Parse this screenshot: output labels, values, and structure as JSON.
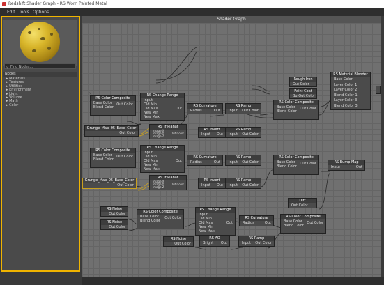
{
  "window": {
    "title": "Redshift Shader Graph - RS Worn Painted Metal"
  },
  "menu": [
    "Edit",
    "Tools",
    "Options"
  ],
  "left_panel": {
    "search_placeholder": "Find Nodes...",
    "tree_header": "Nodes",
    "tree_items": [
      "Materials",
      "Textures",
      "Utilities",
      "Environment",
      "Light",
      "Volume",
      "Math",
      "Color"
    ]
  },
  "graph": {
    "title": "Shader Graph",
    "nodes": [
      {
        "id": "mat",
        "title": "RS Material Blender",
        "rows": [
          "Base Color",
          "Layer Color 1",
          "Layer Color 2",
          "Blend Color 1",
          "Layer Color 3",
          "Blend Color 3"
        ],
        "out": ""
      },
      {
        "id": "rough",
        "title": "Rough Iron",
        "rows": [
          "Out Color"
        ],
        "out": ""
      },
      {
        "id": "paint",
        "title": "Paint Coat",
        "rows": [
          "Bu Out Color"
        ],
        "out": ""
      },
      {
        "id": "cc1",
        "title": "RS Color Composite",
        "rows": [
          "Base Color",
          "Blend Color"
        ],
        "out": "Out Color"
      },
      {
        "id": "cr1",
        "title": "RS Change Range",
        "rows": [
          "Input",
          "Old Min",
          "Old Max",
          "New Min",
          "New Max"
        ],
        "out": "Out"
      },
      {
        "id": "curv1",
        "title": "RS Curvature",
        "rows": [
          "Radius"
        ],
        "out": "Out"
      },
      {
        "id": "ramp1",
        "title": "RS Ramp",
        "rows": [
          "Input"
        ],
        "out": "Out Color"
      },
      {
        "id": "cc2",
        "title": "RS Color Composite",
        "rows": [
          "Base Color",
          "Blend Color"
        ],
        "out": "Out Color"
      },
      {
        "id": "grunge1",
        "title": "Grunge_Map_05_Base_Color",
        "rows": [],
        "out": "Out Color"
      },
      {
        "id": "tri1",
        "title": "RS TriPlanar",
        "rows": [
          "Image X",
          "Image Y",
          "Image Z"
        ],
        "out": "Out Color"
      },
      {
        "id": "inv1",
        "title": "RS Invert",
        "rows": [
          "Input"
        ],
        "out": "Out"
      },
      {
        "id": "ramp2",
        "title": "RS Ramp",
        "rows": [
          "Input"
        ],
        "out": "Out Color"
      },
      {
        "id": "cc3",
        "title": "RS Color Composite",
        "rows": [
          "Base Color",
          "Blend Color"
        ],
        "out": "Out Color"
      },
      {
        "id": "cr2",
        "title": "RS Change Range",
        "rows": [
          "Input",
          "Old Min",
          "Old Max",
          "New Min",
          "New Max"
        ],
        "out": "Out"
      },
      {
        "id": "curv2",
        "title": "RS Curvature",
        "rows": [
          "Radius"
        ],
        "out": "Out"
      },
      {
        "id": "ramp3",
        "title": "RS Ramp",
        "rows": [
          "Input"
        ],
        "out": "Out Color"
      },
      {
        "id": "cc4",
        "title": "RS Color Composite",
        "rows": [
          "Base Color",
          "Blend Color"
        ],
        "out": "Out Color"
      },
      {
        "id": "bump",
        "title": "RS Bump Map",
        "rows": [
          "Input"
        ],
        "out": "Out"
      },
      {
        "id": "grunge2",
        "title": "Grunge_Map_05_Base_Color",
        "rows": [],
        "out": "Out Color"
      },
      {
        "id": "tri2",
        "title": "RS TriPlanar",
        "rows": [
          "Image X",
          "Image Y",
          "Image Z"
        ],
        "out": "Out Color"
      },
      {
        "id": "inv2",
        "title": "RS Invert",
        "rows": [
          "Input"
        ],
        "out": "Out"
      },
      {
        "id": "ramp4",
        "title": "RS Ramp",
        "rows": [
          "Input"
        ],
        "out": "Out Color"
      },
      {
        "id": "dirt",
        "title": "Dirt",
        "rows": [
          "Out Color"
        ],
        "out": ""
      },
      {
        "id": "noise1",
        "title": "RS Noise",
        "rows": [],
        "out": "Out Color"
      },
      {
        "id": "noise2",
        "title": "RS Noise",
        "rows": [],
        "out": "Out Color"
      },
      {
        "id": "cc5",
        "title": "RS Color Composite",
        "rows": [
          "Base Color",
          "Blend Color"
        ],
        "out": "Out Color"
      },
      {
        "id": "cr3",
        "title": "RS Change Range",
        "rows": [
          "Input",
          "Old Min",
          "Old Max",
          "New Min",
          "New Max"
        ],
        "out": "Out"
      },
      {
        "id": "curv3",
        "title": "RS Curvature",
        "rows": [
          "Radius"
        ],
        "out": "Out"
      },
      {
        "id": "cc6",
        "title": "RS Color Composite",
        "rows": [
          "Base Color",
          "Blend Color"
        ],
        "out": "Out Color"
      },
      {
        "id": "noise3",
        "title": "RS Noise",
        "rows": [],
        "out": "Out Color"
      },
      {
        "id": "ao",
        "title": "RS AO",
        "rows": [
          "Bright"
        ],
        "out": "Out"
      },
      {
        "id": "ramp5",
        "title": "RS Ramp",
        "rows": [
          "Input"
        ],
        "out": "Out Color"
      }
    ]
  },
  "colors": {
    "accent_border": "#f0b400",
    "pin": "#e06060",
    "node_bg": "#4b4b4b",
    "graph_bg": "#707070"
  }
}
